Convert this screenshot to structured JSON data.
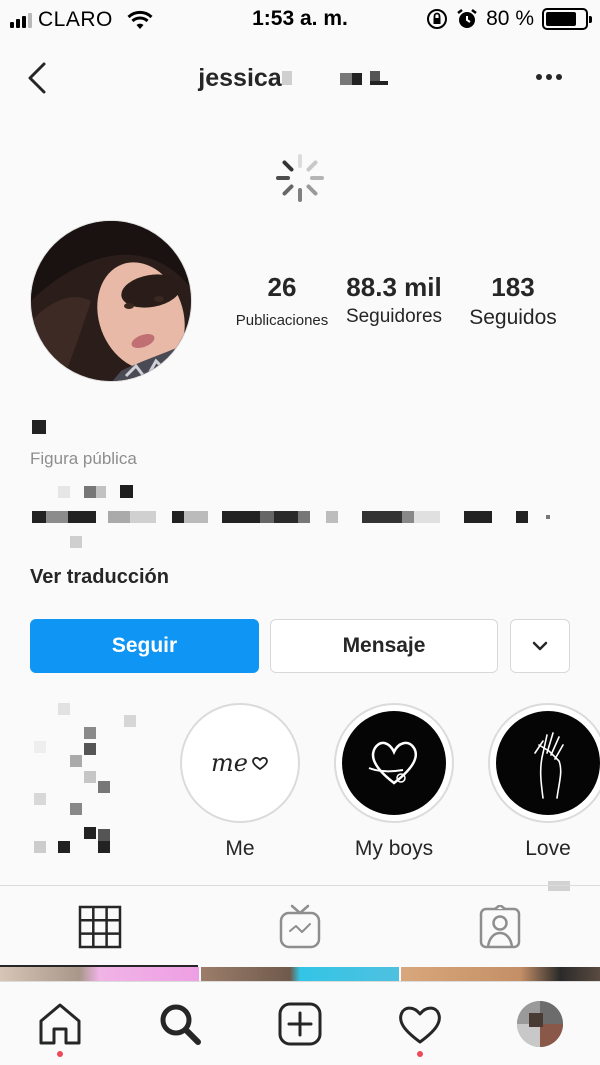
{
  "status_bar": {
    "carrier": "CLARO",
    "time": "1:53 a. m.",
    "battery_percent": "80 %",
    "battery_level": 0.8
  },
  "header": {
    "username": "jessica"
  },
  "profile": {
    "stats": [
      {
        "value": "26",
        "label": "Publicaciones"
      },
      {
        "value": "88.3 mil",
        "label": "Seguidores"
      },
      {
        "value": "183",
        "label": "Seguidos"
      }
    ],
    "category": "Figura pública",
    "translate_link": "Ver traducción"
  },
  "actions": {
    "follow": "Seguir",
    "message": "Mensaje"
  },
  "highlights": [
    {
      "label": "",
      "icon": "pixelated-cover"
    },
    {
      "label": "Me",
      "cover_text": "me"
    },
    {
      "label": "My boys",
      "icon": "heart-scribble-icon"
    },
    {
      "label": "Love",
      "icon": "hands-icon"
    }
  ],
  "tabs": [
    {
      "name": "grid",
      "icon": "grid-icon",
      "active": true
    },
    {
      "name": "igtv",
      "icon": "igtv-icon",
      "active": false
    },
    {
      "name": "tagged",
      "icon": "tagged-icon",
      "active": false
    }
  ],
  "bottom_nav": [
    {
      "name": "home",
      "icon": "home-icon",
      "dot": true
    },
    {
      "name": "search",
      "icon": "search-icon",
      "dot": false
    },
    {
      "name": "new-post",
      "icon": "plus-square-icon",
      "dot": false
    },
    {
      "name": "activity",
      "icon": "heart-icon",
      "dot": true
    },
    {
      "name": "profile",
      "icon": "profile-avatar",
      "dot": false
    }
  ],
  "colors": {
    "accent": "#0f95f3",
    "text": "#262626",
    "muted": "#8e8e8e",
    "border": "#dbdbdb",
    "notification_dot": "#ed4956"
  }
}
